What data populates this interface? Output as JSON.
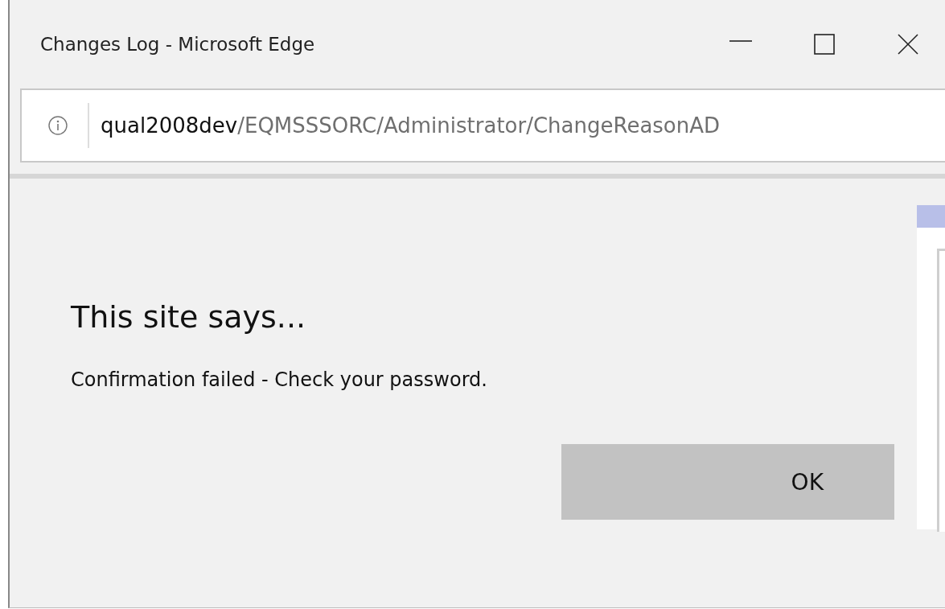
{
  "window": {
    "title": "Changes Log - Microsoft Edge"
  },
  "address_bar": {
    "host": "qual2008dev",
    "path": "/EQMSSSORC/Administrator/ChangeReasonAD"
  },
  "dialog": {
    "heading": "This site says...",
    "message": "Confirmation failed - Check your password.",
    "buttons": [
      "OK"
    ]
  }
}
